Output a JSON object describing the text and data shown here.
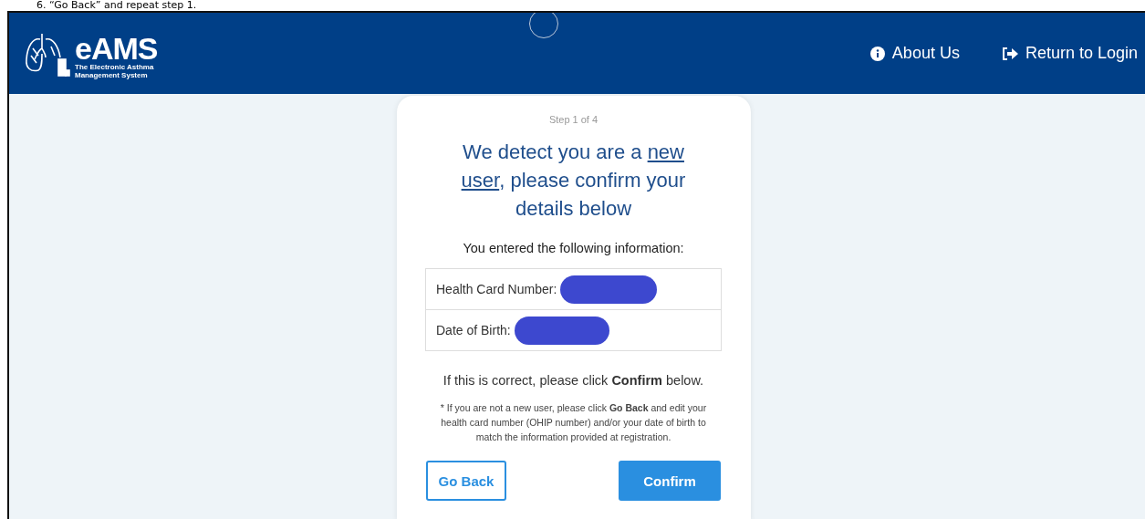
{
  "document_text": "6.  “Go Back” and repeat step 1.",
  "header": {
    "logo_title": "eAMS",
    "logo_subtitle": [
      "The Electronic Asthma",
      "Management System"
    ],
    "loading": true,
    "nav": [
      {
        "kind": "info",
        "label": "About Us"
      },
      {
        "kind": "exit",
        "label": "Return to Login"
      }
    ]
  },
  "card": {
    "step": "Step 1 of 4",
    "heading_before": "We detect you are a ",
    "heading_link": [
      "new",
      "user"
    ],
    "heading_after": ", please confirm your details below",
    "intro": "You entered the following information:",
    "fields": [
      {
        "label": "Health Card Number:",
        "redacted": true
      },
      {
        "label": "Date of Birth:",
        "redacted": true
      }
    ],
    "confirm_text": "If this is correct, please click **Confirm** below.",
    "note": "* If you are not a new user, please click **Go Back** and edit your health card number (OHIP number) and/or your date of birth to match the information provided at registration.",
    "buttons": [
      {
        "kind": "outline",
        "label": "Go Back"
      },
      {
        "kind": "primary",
        "label": "Confirm"
      }
    ]
  }
}
